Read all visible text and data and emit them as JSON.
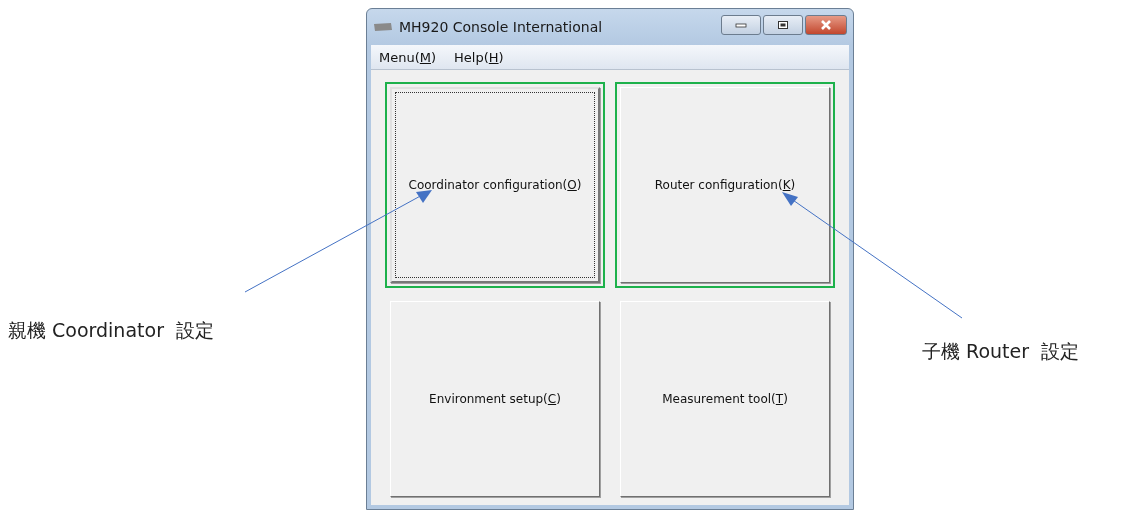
{
  "window": {
    "title": "MH920 Console International"
  },
  "menu": [
    {
      "before": "Menu(",
      "key": "M",
      "after": ")"
    },
    {
      "before": "Help(",
      "key": "H",
      "after": ")"
    }
  ],
  "buttons": [
    {
      "before": "Coordinator configuration(",
      "key": "O",
      "after": ")",
      "focused": true,
      "highlighted": true
    },
    {
      "before": "Router configuration(",
      "key": "K",
      "after": ")",
      "focused": false,
      "highlighted": true
    },
    {
      "before": "Environment setup(",
      "key": "C",
      "after": ")",
      "focused": false,
      "highlighted": false
    },
    {
      "before": "Measurement tool(",
      "key": "T",
      "after": ")",
      "focused": false,
      "highlighted": false
    }
  ],
  "annotations": [
    {
      "text": "親機 Coordinator  設定"
    },
    {
      "text": "子機 Router  設定"
    }
  ]
}
